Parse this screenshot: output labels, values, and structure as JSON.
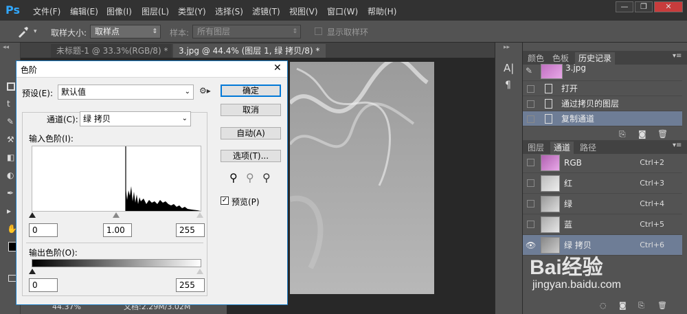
{
  "app": {
    "logo": "Ps"
  },
  "menu": [
    "文件(F)",
    "编辑(E)",
    "图像(I)",
    "图层(L)",
    "类型(Y)",
    "选择(S)",
    "滤镜(T)",
    "视图(V)",
    "窗口(W)",
    "帮助(H)"
  ],
  "window_controls": {
    "minimize": "—",
    "restore": "❐",
    "close": "✕"
  },
  "options": {
    "sample_size_label": "取样大小:",
    "sample_size_value": "取样点",
    "sample_label": "样本:",
    "sample_value": "所有图层",
    "show_ring_label": "显示取样环"
  },
  "doc_tabs": [
    "未标题-1 @ 33.3%(RGB/8) *",
    "3.jpg @ 44.4% (图层 1, 绿 拷贝/8) *"
  ],
  "status": {
    "zoom": "44.37%",
    "doc_size": "文档:2.29M/3.02M"
  },
  "panel_top": {
    "tabs": [
      "颜色",
      "色板",
      "历史记录"
    ],
    "active_tab": "历史记录",
    "snapshot": "3.jpg",
    "history": [
      "打开",
      "通过拷贝的图层",
      "复制通道"
    ]
  },
  "panel_bottom": {
    "tabs": [
      "图层",
      "通道",
      "路径"
    ],
    "active_tab": "通道",
    "channels": [
      {
        "name": "RGB",
        "shortcut": "Ctrl+2"
      },
      {
        "name": "红",
        "shortcut": "Ctrl+3"
      },
      {
        "name": "绿",
        "shortcut": "Ctrl+4"
      },
      {
        "name": "蓝",
        "shortcut": "Ctrl+5"
      },
      {
        "name": "绿 拷贝",
        "shortcut": "Ctrl+6"
      }
    ]
  },
  "dialog": {
    "title": "色阶",
    "preset_label": "预设(E):",
    "preset_value": "默认值",
    "channel_label": "通道(C):",
    "channel_value": "绿 拷贝",
    "input_levels_label": "输入色阶(I):",
    "input_black": "0",
    "input_gamma": "1.00",
    "input_white": "255",
    "output_levels_label": "输出色阶(O):",
    "output_black": "0",
    "output_white": "255",
    "buttons": {
      "ok": "确定",
      "cancel": "取消",
      "auto": "自动(A)",
      "options": "选项(T)..."
    },
    "preview_label": "预览(P)",
    "preview_checked": true
  },
  "watermark": {
    "logo": "Bai经验",
    "url": "jingyan.baidu.com"
  }
}
